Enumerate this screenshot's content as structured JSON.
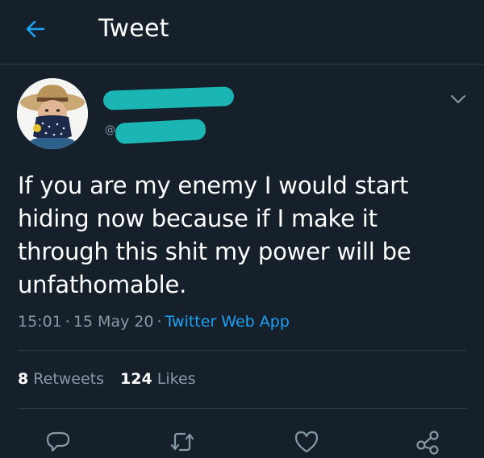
{
  "header": {
    "title": "Tweet",
    "back_icon": "arrow-left-icon"
  },
  "author": {
    "avatar": "avatar-photo",
    "handle_prefix": "@",
    "name_redacted": true,
    "handle_redacted": true,
    "redaction_color": "#1bb5b3"
  },
  "tweet": {
    "text": "If you are my enemy I would start hiding now because if I make it through this shit my power will be unfathomable.",
    "time": "15:01",
    "date": "15 May 20",
    "separator": "·",
    "source": "Twitter Web App"
  },
  "stats": {
    "retweets_count": "8",
    "retweets_label": "Retweets",
    "likes_count": "124",
    "likes_label": "Likes"
  },
  "actions": [
    {
      "icon": "reply-icon"
    },
    {
      "icon": "retweet-icon"
    },
    {
      "icon": "like-icon"
    },
    {
      "icon": "share-icon"
    }
  ],
  "colors": {
    "background": "#15202b",
    "accent": "#1da1f2",
    "secondary_text": "#8899a6",
    "divider": "#2f3b47"
  }
}
